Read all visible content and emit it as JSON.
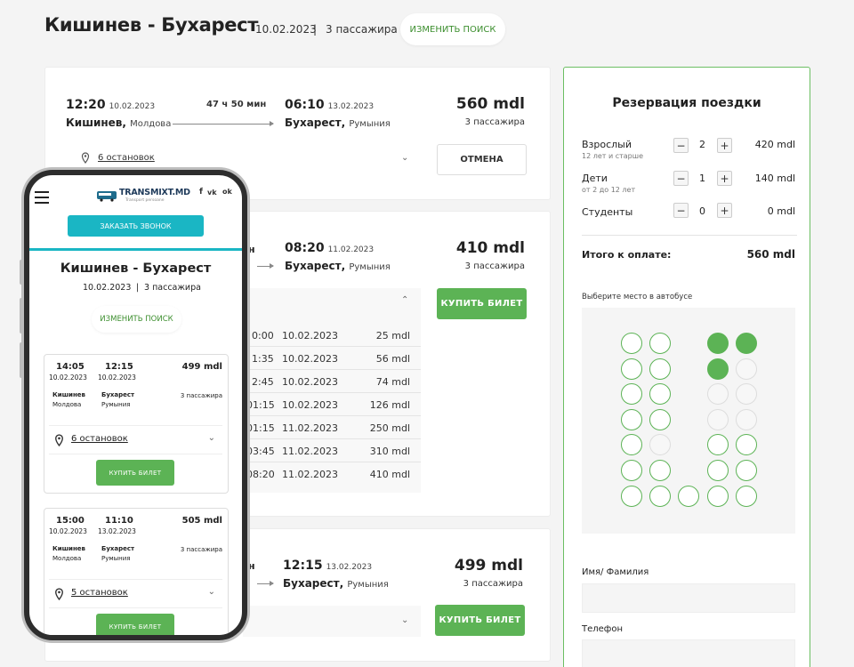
{
  "header": {
    "route": "Кишинев - Бухарест",
    "date": "10.02.2023",
    "sep": "|",
    "passengers": "3 пассажира",
    "change_search": "ИЗМЕНИТЬ ПОИСК"
  },
  "trips": [
    {
      "dep_time": "12:20",
      "dep_date": "10.02.2023",
      "duration": "47 ч 50 мин",
      "arr_time": "06:10",
      "arr_date": "13.02.2023",
      "from_city": "Кишинев,",
      "from_country": "Молдова",
      "to_city": "Бухарест,",
      "to_country": "Румыния",
      "price": "560 mdl",
      "pax": "3 пассажира",
      "stops": "6 остановок",
      "action": "ОТМЕНА"
    },
    {
      "dep_time_partial": "н",
      "arr_time": "08:20",
      "arr_date": "11.02.2023",
      "to_city": "Бухарест,",
      "to_country": "Румыния",
      "price": "410 mdl",
      "pax": "3 пассажира",
      "action": "КУПИТЬ БИЛЕТ",
      "schedule": [
        {
          "time": "0:00",
          "date": "10.02.2023",
          "price": "25 mdl"
        },
        {
          "time": "1:35",
          "date": "10.02.2023",
          "price": "56 mdl"
        },
        {
          "time": "2:45",
          "date": "10.02.2023",
          "price": "74 mdl"
        },
        {
          "time": "01:15",
          "date": "10.02.2023",
          "price": "126 mdl"
        },
        {
          "time": "01:15",
          "date": "11.02.2023",
          "price": "250 mdl"
        },
        {
          "time": "03:45",
          "date": "11.02.2023",
          "price": "310 mdl"
        },
        {
          "time": "08:20",
          "date": "11.02.2023",
          "price": "410 mdl"
        }
      ]
    },
    {
      "dep_time_partial": "н",
      "arr_time": "12:15",
      "arr_date": "13.02.2023",
      "to_city": "Бухарест,",
      "to_country": "Румыния",
      "price": "499 mdl",
      "pax": "3 пассажира",
      "action": "КУПИТЬ БИЛЕТ"
    }
  ],
  "booking": {
    "title": "Резервация поездки",
    "rows": [
      {
        "label": "Взрослый",
        "sub": "12 лет и старше",
        "count": "2",
        "price": "420 mdl"
      },
      {
        "label": "Дети",
        "sub": "от 2 до 12 лет",
        "count": "1",
        "price": "140 mdl"
      },
      {
        "label": "Студенты",
        "sub": "",
        "count": "0",
        "price": "0 mdl"
      }
    ],
    "minus": "−",
    "plus": "+",
    "total_label": "Итого к оплате:",
    "total_value": "560 mdl",
    "seat_label": "Выберите место в автобусе",
    "name_label": "Имя/ Фамилия",
    "phone_label": "Телефон"
  },
  "mobile": {
    "logo": "TRANSMIXT.MD",
    "logo_sub": "Transport persoane",
    "socials": [
      "f",
      "vk",
      "ok"
    ],
    "call_button": "ЗАКАЗАТЬ ЗВОНОК",
    "route": "Кишинев - Бухарест",
    "date": "10.02.2023",
    "sep": "|",
    "passengers": "3 пассажира",
    "change_search": "ИЗМЕНИТЬ ПОИСК",
    "trips": [
      {
        "dep_time": "14:05",
        "dep_date": "10.02.2023",
        "arr_time": "12:15",
        "arr_date": "10.02.2023",
        "price": "499 mdl",
        "from_city": "Кишинев",
        "from_country": "Молдова",
        "to_city": "Бухарест",
        "to_country": "Румыния",
        "pax": "3 пассажира",
        "stops": "6 остановок",
        "action": "КУПИТЬ БИЛЕТ"
      },
      {
        "dep_time": "15:00",
        "dep_date": "10.02.2023",
        "arr_time": "11:10",
        "arr_date": "13.02.2023",
        "price": "505 mdl",
        "from_city": "Кишинев",
        "from_country": "Молдова",
        "to_city": "Бухарест",
        "to_country": "Румыния",
        "pax": "3 пассажира",
        "stops": "5 остановок",
        "action": "КУПИТЬ БИЛЕТ"
      }
    ]
  },
  "colors": {
    "accent": "#5cb355",
    "teal": "#1ab6c4",
    "border_active": "#6cbf63"
  },
  "seat_map": {
    "rows": [
      [
        "free",
        "free",
        null,
        "taken",
        "taken"
      ],
      [
        "free",
        "free",
        null,
        "taken",
        "na"
      ],
      [
        "free",
        "free",
        null,
        "na",
        "na"
      ],
      [
        "free",
        "free",
        null,
        "na",
        "na"
      ],
      [
        "free",
        "na",
        null,
        "free",
        "free"
      ],
      [
        "free",
        "free",
        null,
        "free",
        "free"
      ],
      [
        "free",
        "free",
        "free",
        "free",
        "free"
      ]
    ]
  }
}
